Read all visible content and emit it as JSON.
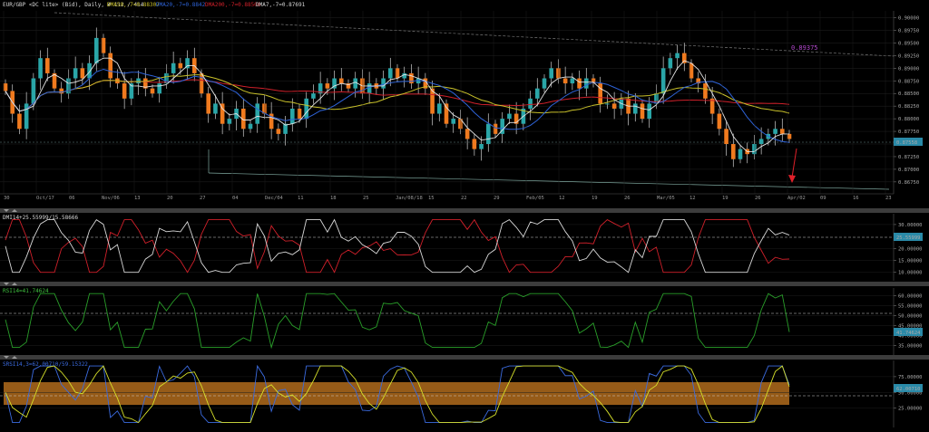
{
  "header": {
    "symbol": "EUR/GBP <DC lite> (Bid), Daily, # 112 / 414",
    "dma50": "DMA50,-7=0.88307",
    "dma20": "DMA20,-7=0.8842",
    "dma200": "DMA200,-7=0.88506",
    "dma7": "DMA7,-7=0.87691"
  },
  "colors": {
    "background": "#000000",
    "bull_candle": "#2aa6a8",
    "bear_candle": "#f07a1e",
    "dma50": "#c9c12a",
    "dma20": "#2e63d8",
    "dma200": "#d0202a",
    "dma7": "#e6e6e6",
    "panel_bar": "#3c3c3c",
    "value_box": "#2a8aa8"
  },
  "price_panel": {
    "y_ticks": [
      "0.90000",
      "0.89750",
      "0.89500",
      "0.89250",
      "0.89000",
      "0.88750",
      "0.88500",
      "0.88250",
      "0.88000",
      "0.87750",
      "0.87500",
      "0.87250",
      "0.87000",
      "0.86750"
    ],
    "current_price": "0.87558",
    "trendline_label": "0.89375"
  },
  "x_axis": {
    "labels": [
      "30",
      "Oct/17",
      "06",
      "Nov/06",
      "13",
      "20",
      "27",
      "04",
      "Dec/04",
      "11",
      "18",
      "25",
      "Jan/08/18",
      "15",
      "22",
      "29",
      "Feb/05",
      "12",
      "19",
      "26",
      "Mar/05",
      "12",
      "19",
      "26",
      "Apr/02",
      "09",
      "16",
      "23"
    ]
  },
  "dmi_panel": {
    "title": "DMI14+25.55999/15.58666",
    "plus_value": "25.55999",
    "minus_value": "15.58666",
    "y_ticks": [
      "30.00000",
      "20.00000",
      "15.00000",
      "10.00000"
    ],
    "current": "25.55999"
  },
  "rsi_panel": {
    "title": "RSI14=41.74624",
    "value": "41.74624",
    "y_ticks": [
      "60.00000",
      "55.00000",
      "50.00000",
      "45.00000",
      "40.00000",
      "35.00000"
    ],
    "current": "41.74624"
  },
  "srsi_panel": {
    "title": "SRSI14,3=62.00710/59.15322",
    "k_value": "62.00710",
    "d_value": "59.15322",
    "y_ticks": [
      "75.00000",
      "50.00000",
      "25.00000"
    ],
    "current": "62.00710"
  },
  "chart_data": {
    "type": "line",
    "title": "EUR/GBP <DC lite> (Bid), Daily",
    "instrument": "EUR/GBP",
    "timeframe": "Daily",
    "series": [
      {
        "name": "DMA50,-7",
        "last": 0.88307
      },
      {
        "name": "DMA20,-7",
        "last": 0.8842
      },
      {
        "name": "DMA200,-7",
        "last": 0.88506
      },
      {
        "name": "DMA7,-7",
        "last": 0.87691
      }
    ],
    "close": [
      0.8855,
      0.881,
      0.878,
      0.883,
      0.888,
      0.892,
      0.889,
      0.886,
      0.885,
      0.888,
      0.89,
      0.888,
      0.891,
      0.896,
      0.893,
      0.888,
      0.887,
      0.884,
      0.887,
      0.888,
      0.886,
      0.885,
      0.887,
      0.889,
      0.891,
      0.89,
      0.892,
      0.889,
      0.885,
      0.881,
      0.883,
      0.879,
      0.88,
      0.882,
      0.878,
      0.879,
      0.883,
      0.881,
      0.878,
      0.877,
      0.879,
      0.882,
      0.88,
      0.884,
      0.885,
      0.887,
      0.886,
      0.888,
      0.887,
      0.886,
      0.888,
      0.885,
      0.887,
      0.886,
      0.888,
      0.89,
      0.888,
      0.889,
      0.887,
      0.888,
      0.886,
      0.881,
      0.883,
      0.879,
      0.88,
      0.878,
      0.876,
      0.874,
      0.875,
      0.879,
      0.877,
      0.88,
      0.881,
      0.879,
      0.882,
      0.884,
      0.886,
      0.888,
      0.89,
      0.888,
      0.887,
      0.888,
      0.886,
      0.888,
      0.887,
      0.883,
      0.883,
      0.882,
      0.884,
      0.881,
      0.883,
      0.88,
      0.883,
      0.885,
      0.89,
      0.892,
      0.893,
      0.891,
      0.888,
      0.887,
      0.884,
      0.881,
      0.878,
      0.875,
      0.872,
      0.874,
      0.873,
      0.875,
      0.876,
      0.877,
      0.878,
      0.877,
      0.876
    ],
    "y_axis_range": [
      0.8655,
      0.901
    ],
    "indicators": {
      "DMI14": {
        "plus": 25.55999,
        "minus": 15.58666
      },
      "RSI14": 41.74624,
      "SRSI14,3": {
        "k": 62.0071,
        "d": 59.15322
      }
    }
  }
}
